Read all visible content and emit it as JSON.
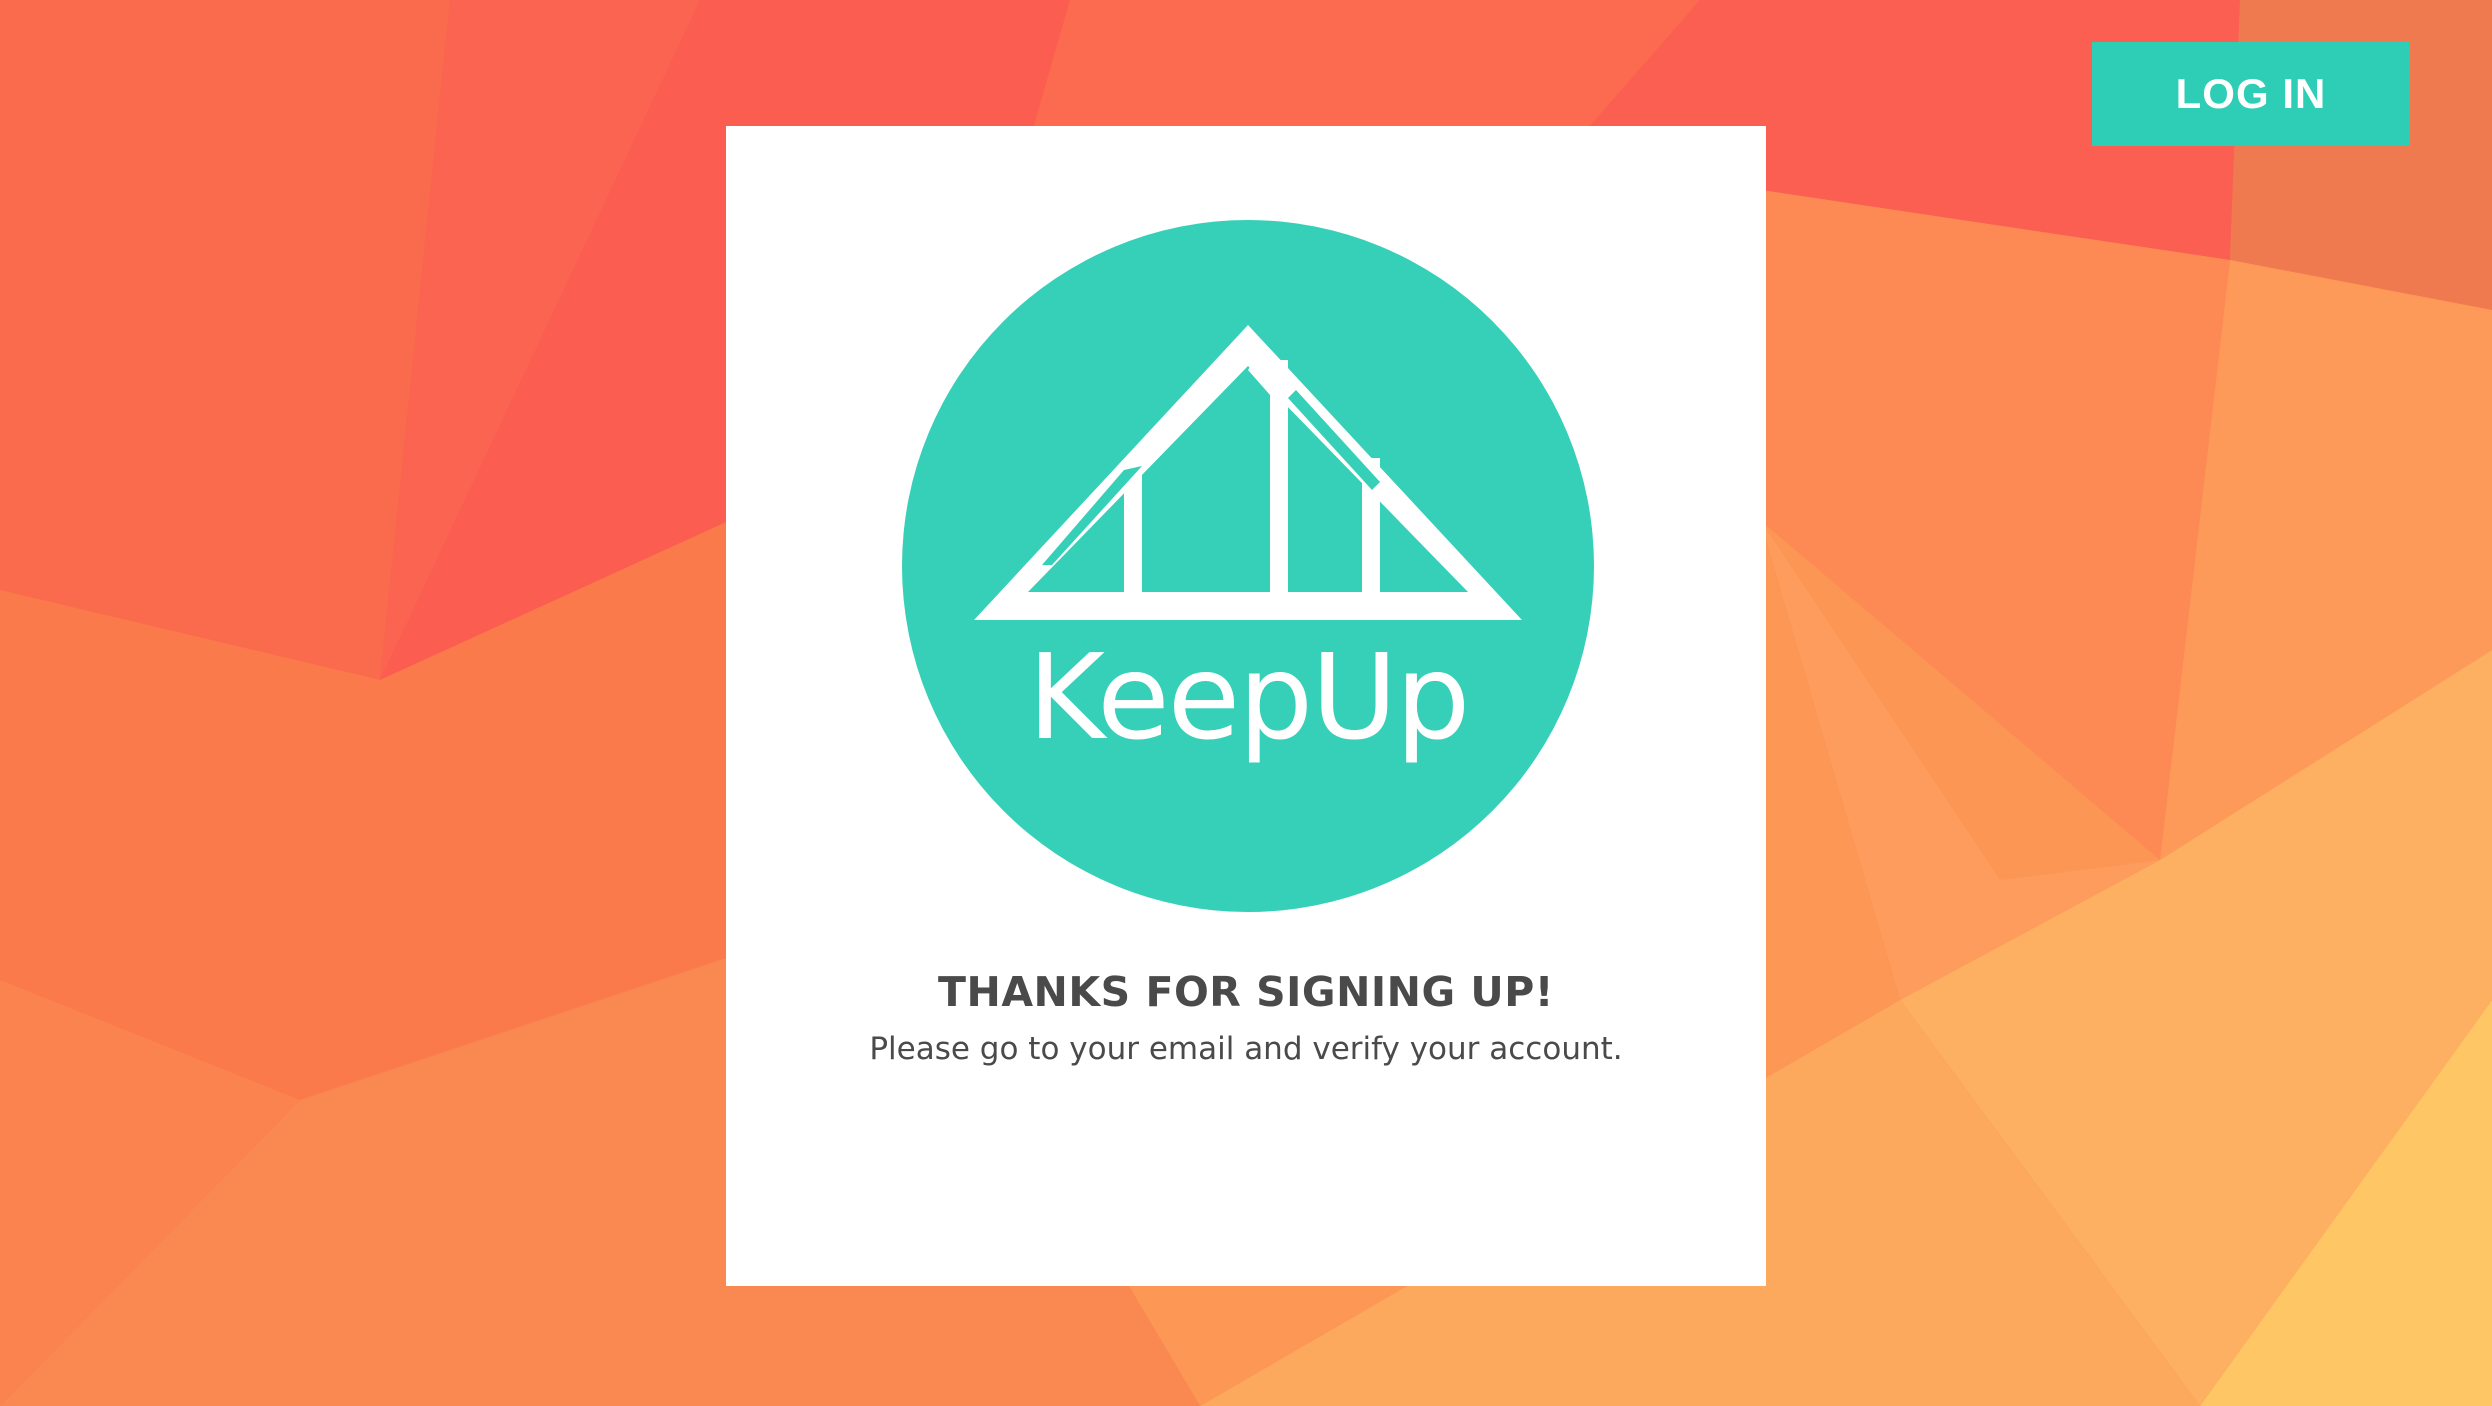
{
  "header": {
    "login_label": "LOG IN"
  },
  "card": {
    "logo_text": "KeepUp",
    "headline": "THANKS FOR SIGNING UP!",
    "message": "Please go to your email and verify your account."
  },
  "colors": {
    "accent": "#2ecdb5",
    "text": "#4a4a4a",
    "background_primary": "#f97348",
    "background_warm": "#fbb862",
    "card": "#ffffff"
  },
  "icons": {
    "logo": "keepup-house-logo-icon"
  }
}
